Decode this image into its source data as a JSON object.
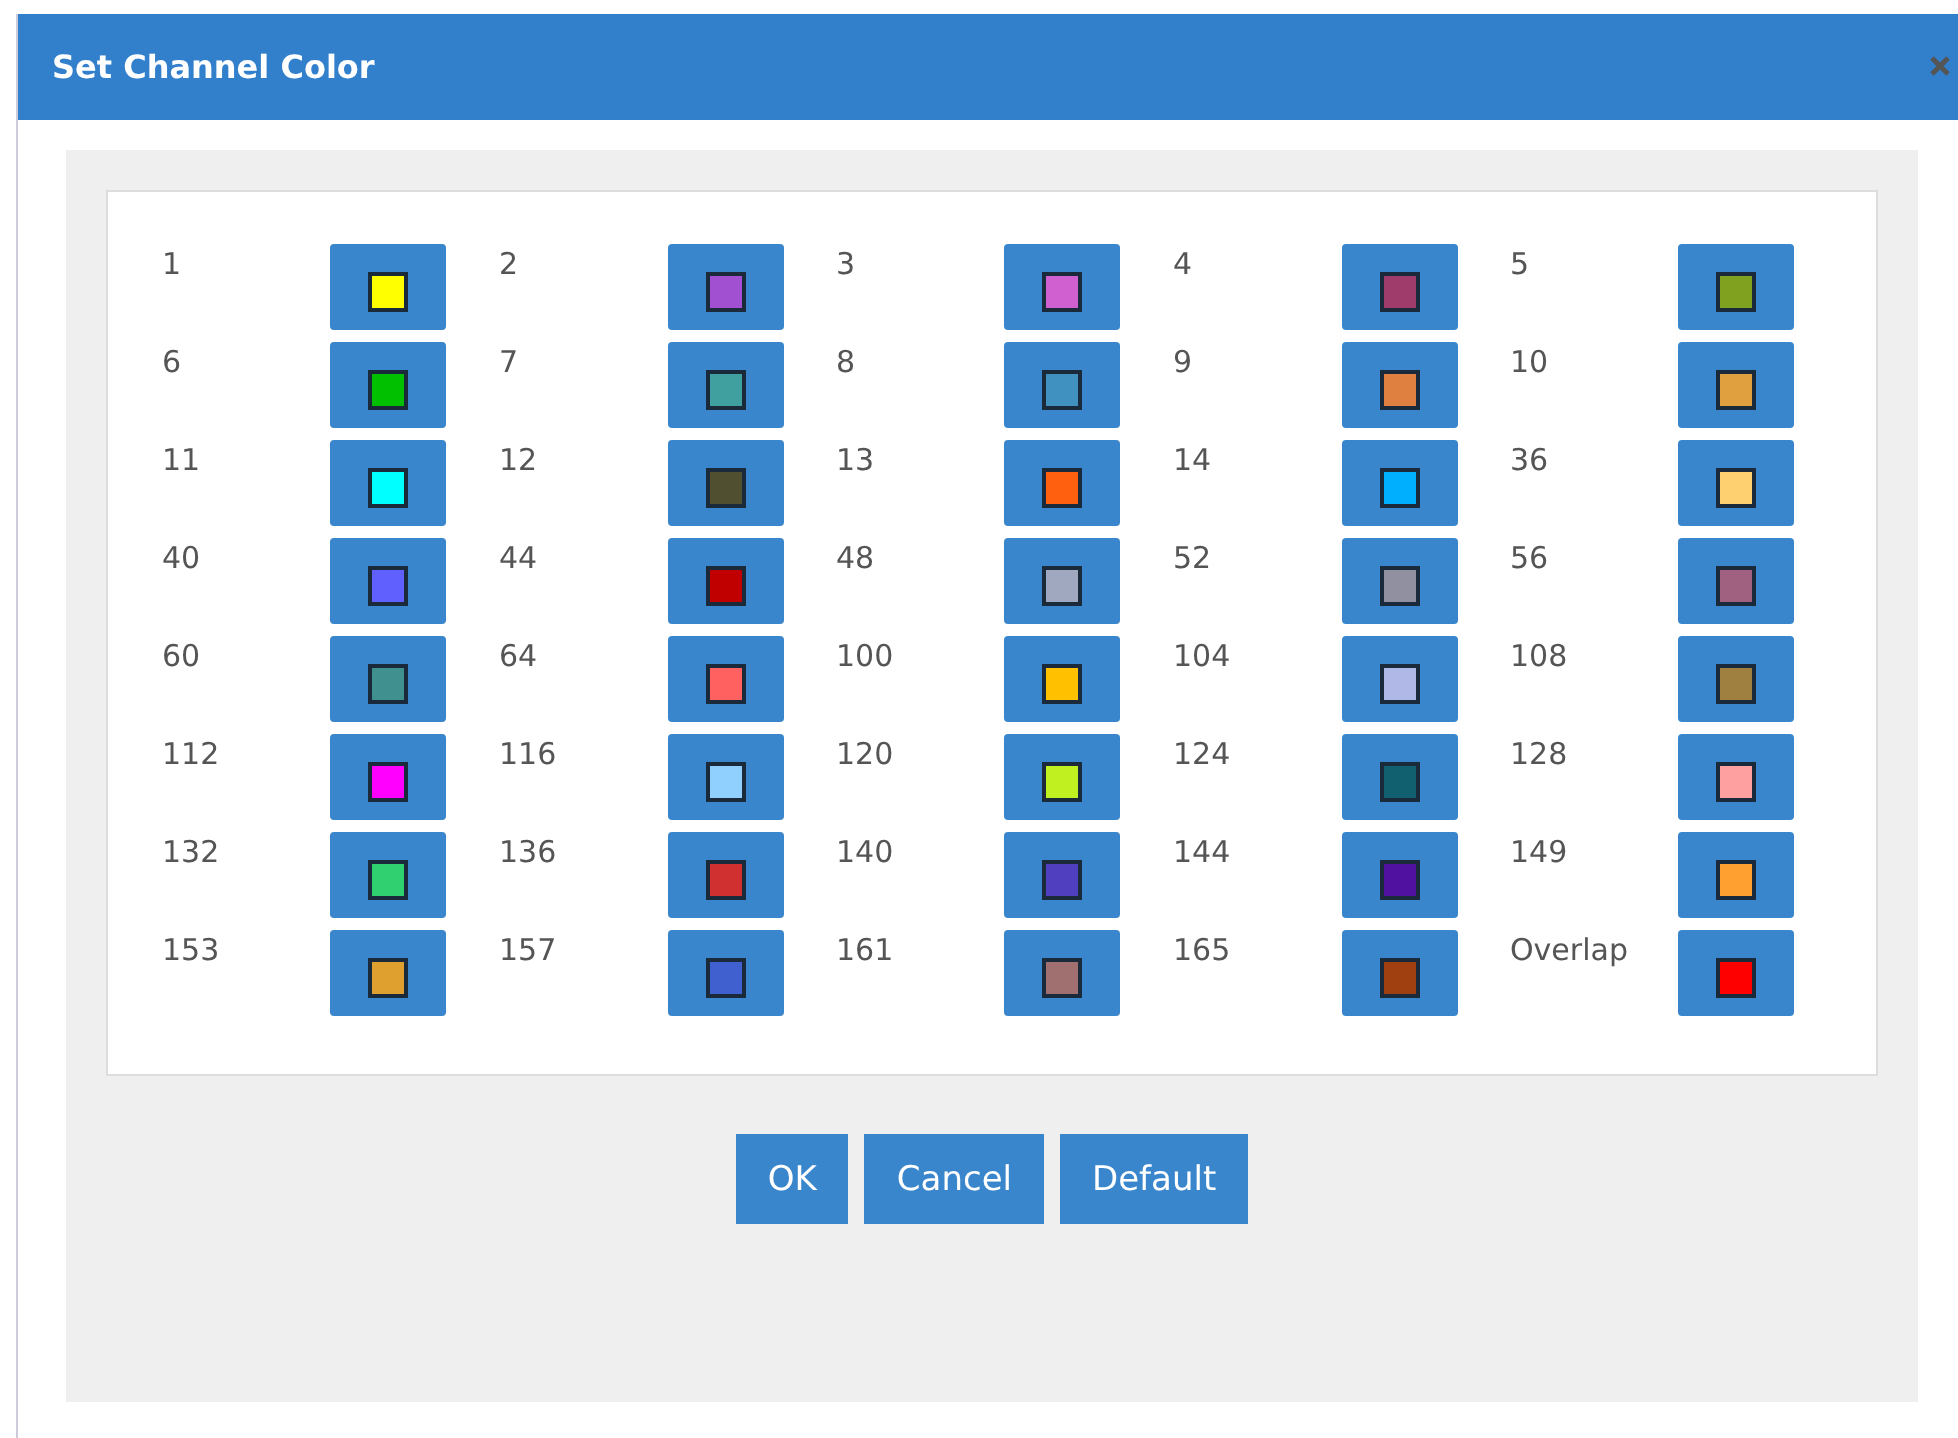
{
  "dialog": {
    "title": "Set Channel Color"
  },
  "channels": [
    {
      "label": "1",
      "color": "#ffff00"
    },
    {
      "label": "2",
      "color": "#a050d0"
    },
    {
      "label": "3",
      "color": "#d060d0"
    },
    {
      "label": "4",
      "color": "#a03c6c"
    },
    {
      "label": "5",
      "color": "#80a020"
    },
    {
      "label": "6",
      "color": "#00c000"
    },
    {
      "label": "7",
      "color": "#40a0a0"
    },
    {
      "label": "8",
      "color": "#4090c0"
    },
    {
      "label": "9",
      "color": "#e08040"
    },
    {
      "label": "10",
      "color": "#e0a040"
    },
    {
      "label": "11",
      "color": "#00ffff"
    },
    {
      "label": "12",
      "color": "#505030"
    },
    {
      "label": "13",
      "color": "#ff6010"
    },
    {
      "label": "14",
      "color": "#00b0ff"
    },
    {
      "label": "36",
      "color": "#ffd070"
    },
    {
      "label": "40",
      "color": "#6060ff"
    },
    {
      "label": "44",
      "color": "#c00000"
    },
    {
      "label": "48",
      "color": "#a0a8c0"
    },
    {
      "label": "52",
      "color": "#9090a0"
    },
    {
      "label": "56",
      "color": "#a06080"
    },
    {
      "label": "60",
      "color": "#409090"
    },
    {
      "label": "64",
      "color": "#ff6060"
    },
    {
      "label": "100",
      "color": "#ffc000"
    },
    {
      "label": "104",
      "color": "#b0b8e8"
    },
    {
      "label": "108",
      "color": "#a08040"
    },
    {
      "label": "112",
      "color": "#ff00ff"
    },
    {
      "label": "116",
      "color": "#90d0ff"
    },
    {
      "label": "120",
      "color": "#c0f020"
    },
    {
      "label": "124",
      "color": "#106070"
    },
    {
      "label": "128",
      "color": "#ffa0a0"
    },
    {
      "label": "132",
      "color": "#30d070"
    },
    {
      "label": "136",
      "color": "#d03030"
    },
    {
      "label": "140",
      "color": "#5040c0"
    },
    {
      "label": "144",
      "color": "#5010a0"
    },
    {
      "label": "149",
      "color": "#ffa030"
    },
    {
      "label": "153",
      "color": "#e0a030"
    },
    {
      "label": "157",
      "color": "#4060d0"
    },
    {
      "label": "161",
      "color": "#a07070"
    },
    {
      "label": "165",
      "color": "#a04010"
    },
    {
      "label": "Overlap",
      "color": "#ff0000"
    }
  ],
  "buttons": [
    "OK",
    "Cancel",
    "Default"
  ]
}
